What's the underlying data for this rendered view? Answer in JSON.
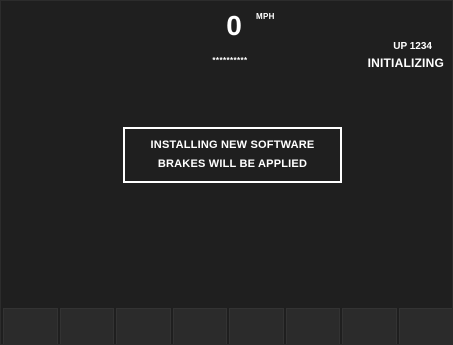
{
  "speedometer": {
    "value": "0",
    "unit": "MPH",
    "masked_value": "**********"
  },
  "locomotive": {
    "id": "UP 1234",
    "status": "INITIALIZING"
  },
  "message": {
    "line1": "INSTALLING NEW SOFTWARE",
    "line2": "BRAKES WILL BE APPLIED"
  },
  "softkeys": {
    "count": 8,
    "labels": [
      "",
      "",
      "",
      "",
      "",
      "",
      "",
      ""
    ]
  },
  "colors": {
    "background": "#1f1f1f",
    "text": "#ffffff",
    "softkey": "#2b2b2b"
  }
}
